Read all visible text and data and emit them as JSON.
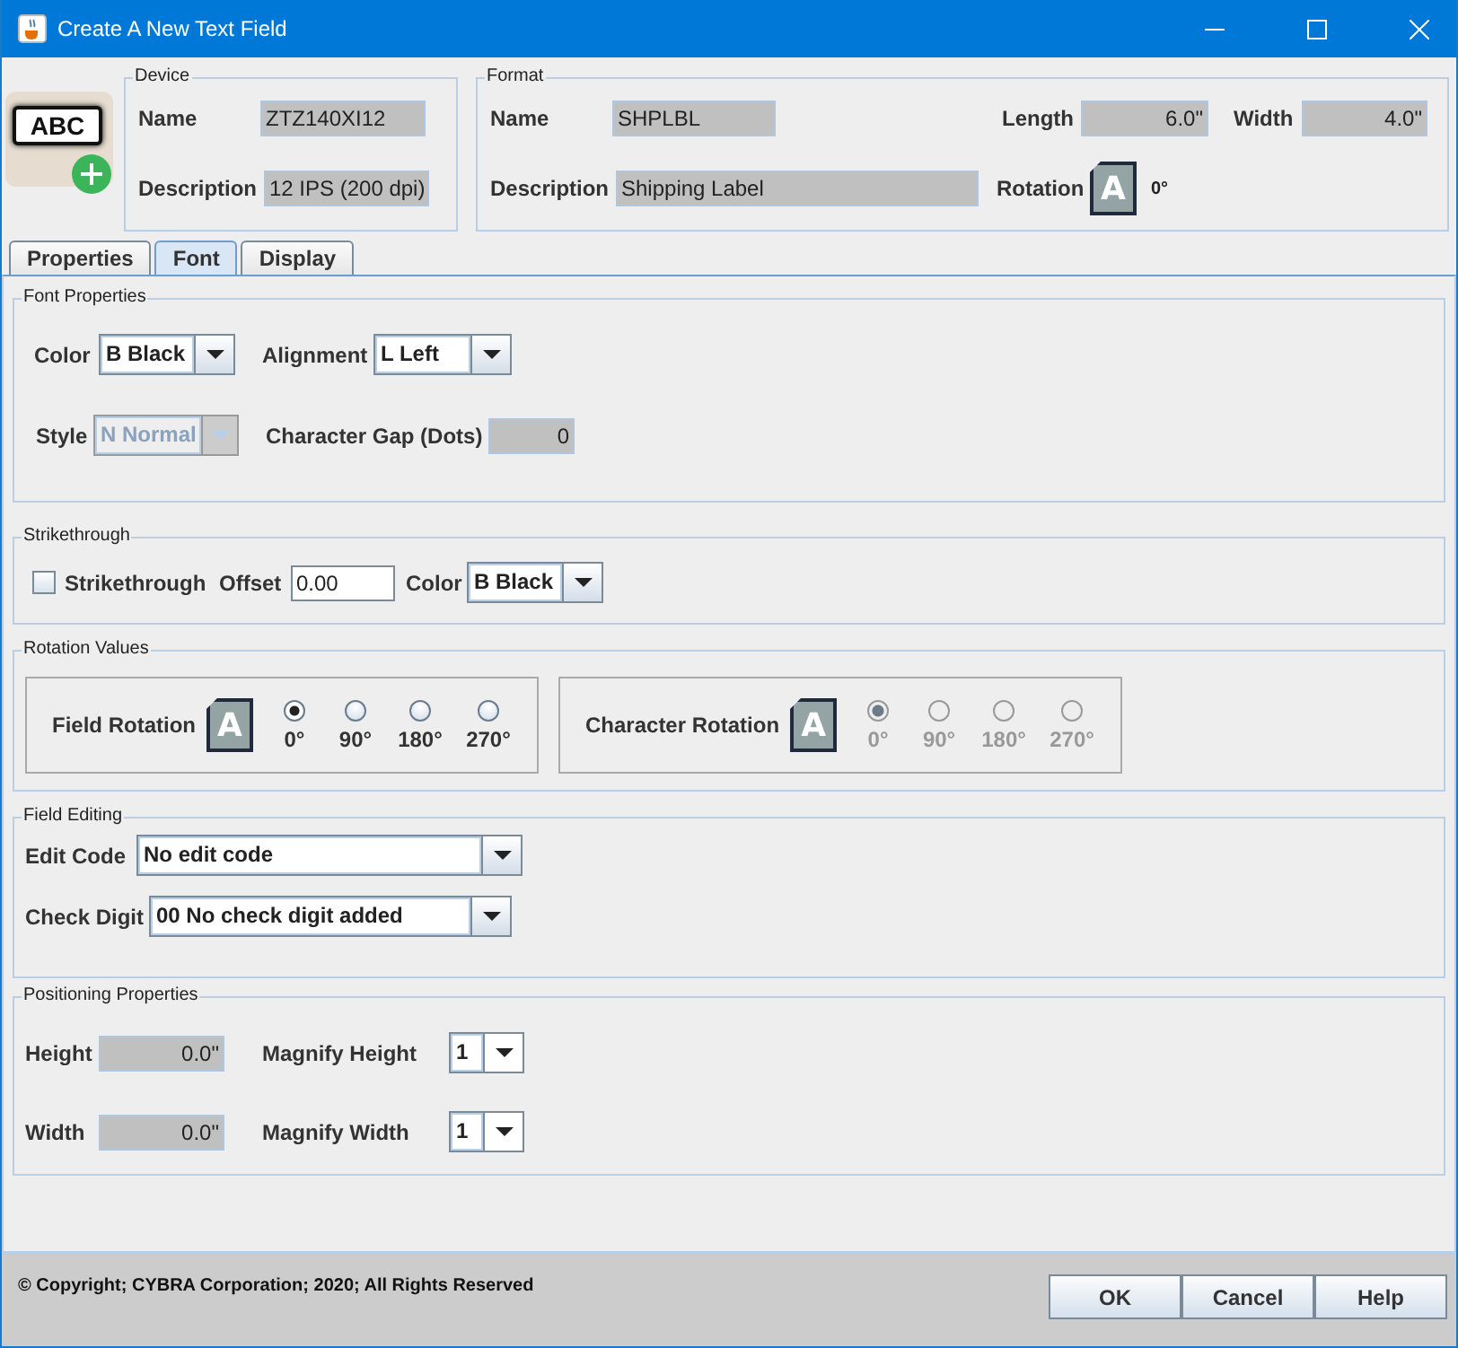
{
  "window": {
    "title": "Create A New Text Field"
  },
  "app_icon": {
    "text": "ABC"
  },
  "device": {
    "legend": "Device",
    "name": {
      "label": "Name",
      "value": "ZTZ140XI12"
    },
    "description": {
      "label": "Description",
      "value": "12 IPS (200 dpi)"
    }
  },
  "format": {
    "legend": "Format",
    "name": {
      "label": "Name",
      "value": "SHPLBL"
    },
    "description": {
      "label": "Description",
      "value": "Shipping Label"
    },
    "length": {
      "label": "Length",
      "value": "6.0\""
    },
    "width": {
      "label": "Width",
      "value": "4.0\""
    },
    "rotation": {
      "label": "Rotation",
      "icon_text": "A",
      "value": "0°"
    }
  },
  "tabs": [
    {
      "label": "Properties",
      "selected": false
    },
    {
      "label": "Font",
      "selected": true
    },
    {
      "label": "Display",
      "selected": false
    }
  ],
  "font_properties": {
    "legend": "Font Properties",
    "color": {
      "label": "Color",
      "value": "B Black"
    },
    "alignment": {
      "label": "Alignment",
      "value": "L Left"
    },
    "style": {
      "label": "Style",
      "value": "N Normal",
      "disabled": true
    },
    "character_gap": {
      "label": "Character Gap (Dots)",
      "value": "0"
    }
  },
  "strikethrough": {
    "legend": "Strikethrough",
    "checkbox": {
      "label": "Strikethrough",
      "checked": false
    },
    "offset": {
      "label": "Offset",
      "value": "0.00"
    },
    "color": {
      "label": "Color",
      "value": "B Black"
    }
  },
  "rotation_values": {
    "legend": "Rotation Values",
    "groups": [
      {
        "label": "Field Rotation",
        "icon_text": "A",
        "disabled": false,
        "options": [
          {
            "label": "0°",
            "selected": true
          },
          {
            "label": "90°",
            "selected": false
          },
          {
            "label": "180°",
            "selected": false
          },
          {
            "label": "270°",
            "selected": false
          }
        ]
      },
      {
        "label": "Character Rotation",
        "icon_text": "A",
        "disabled": true,
        "options": [
          {
            "label": "0°",
            "selected": true
          },
          {
            "label": "90°",
            "selected": false
          },
          {
            "label": "180°",
            "selected": false
          },
          {
            "label": "270°",
            "selected": false
          }
        ]
      }
    ]
  },
  "field_editing": {
    "legend": "Field Editing",
    "edit_code": {
      "label": "Edit Code",
      "value": "No edit code"
    },
    "check_digit": {
      "label": "Check Digit",
      "value": "00 No check digit added"
    }
  },
  "positioning": {
    "legend": "Positioning Properties",
    "height": {
      "label": "Height",
      "value": "0.0\""
    },
    "magnify_height": {
      "label": "Magnify Height",
      "value": "1"
    },
    "width": {
      "label": "Width",
      "value": "0.0\""
    },
    "magnify_width": {
      "label": "Magnify Width",
      "value": "1"
    }
  },
  "footer": {
    "copyright": "© Copyright; CYBRA Corporation; 2020; All Rights Reserved",
    "buttons": [
      "OK",
      "Cancel",
      "Help"
    ]
  }
}
